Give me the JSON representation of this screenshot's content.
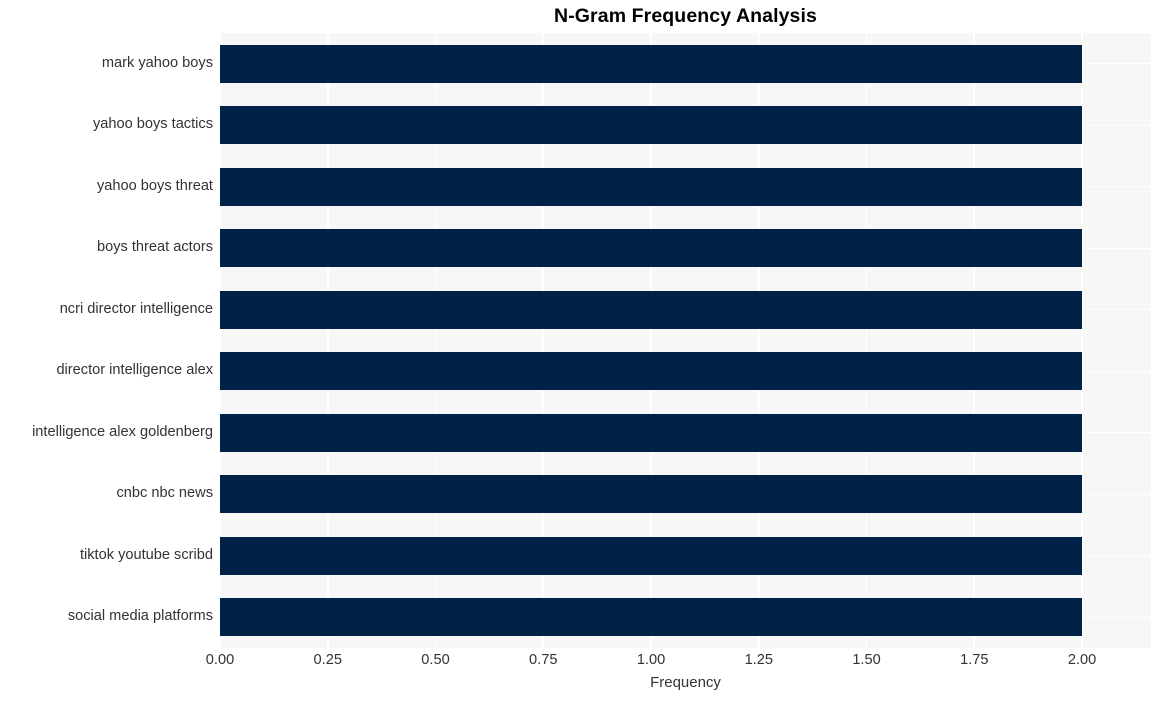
{
  "chart_data": {
    "type": "bar",
    "orientation": "horizontal",
    "title": "N-Gram Frequency Analysis",
    "xlabel": "Frequency",
    "ylabel": "",
    "categories": [
      "mark yahoo boys",
      "yahoo boys tactics",
      "yahoo boys threat",
      "boys threat actors",
      "ncri director intelligence",
      "director intelligence alex",
      "intelligence alex goldenberg",
      "cnbc nbc news",
      "tiktok youtube scribd",
      "social media platforms"
    ],
    "values": [
      2,
      2,
      2,
      2,
      2,
      2,
      2,
      2,
      2,
      2
    ],
    "xlim": [
      0.0,
      2.16
    ],
    "xticks": [
      0.0,
      0.25,
      0.5,
      0.75,
      1.0,
      1.25,
      1.5,
      1.75,
      2.0
    ],
    "xtick_labels": [
      "0.00",
      "0.25",
      "0.50",
      "0.75",
      "1.00",
      "1.25",
      "1.50",
      "1.75",
      "2.00"
    ],
    "grid": true,
    "legend": null,
    "bar_color": "#012247",
    "plot_background": "#f7f7f7",
    "gridline_color": "#ffffff",
    "figure_background": "#ffffff",
    "text_color": "#333333",
    "title_color": "#000000"
  }
}
